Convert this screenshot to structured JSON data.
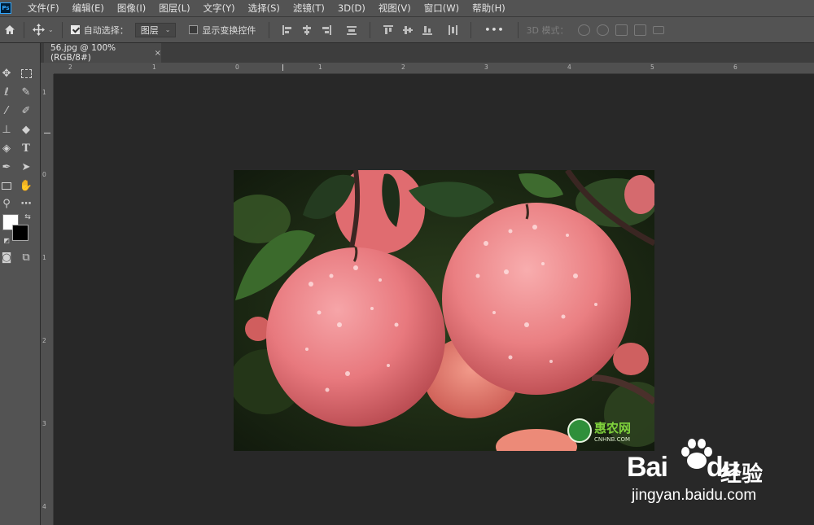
{
  "app": {
    "logo": "Ps"
  },
  "menu": [
    "文件(F)",
    "编辑(E)",
    "图像(I)",
    "图层(L)",
    "文字(Y)",
    "选择(S)",
    "滤镜(T)",
    "3D(D)",
    "视图(V)",
    "窗口(W)",
    "帮助(H)"
  ],
  "options": {
    "auto_select_label": "自动选择：",
    "auto_select_checked": true,
    "auto_select_target": "图层",
    "show_transform_label": "显示变换控件",
    "show_transform_checked": false,
    "more": "•••",
    "mode3d_label": "3D 模式："
  },
  "document": {
    "tab_title": "56.jpg @ 100%(RGB/8#)",
    "close_glyph": "×"
  },
  "ruler": {
    "top_labels": [
      "2",
      "1",
      "0",
      "1",
      "2",
      "3",
      "4",
      "5",
      "6"
    ],
    "left_labels": [
      "1",
      "0",
      "1",
      "2",
      "3",
      "4"
    ]
  },
  "image": {
    "logo_text": "惠农网",
    "logo_sub": "CNHNB.COM"
  },
  "watermark": {
    "brand": "Bai",
    "brand2": "du",
    "cn": "经验",
    "url": "jingyan.baidu.com"
  },
  "colors": {
    "foreground": "#ffffff",
    "background": "#000000",
    "ui_panel": "#535353",
    "canvas_bg": "#282828"
  }
}
